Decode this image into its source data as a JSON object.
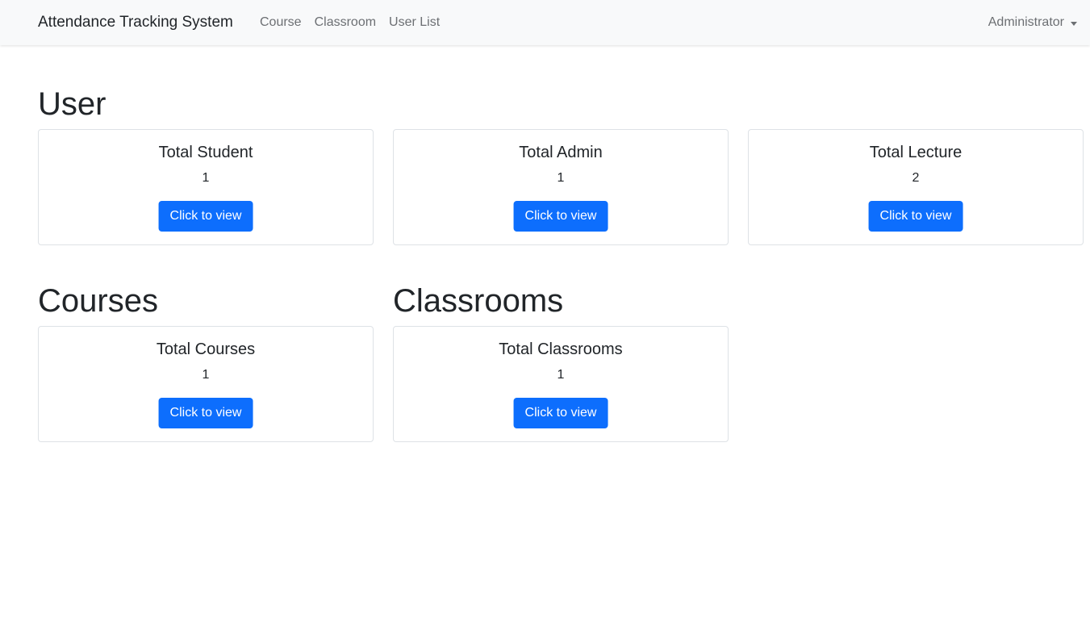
{
  "navbar": {
    "brand": "Attendance Tracking System",
    "links": [
      "Course",
      "Classroom",
      "User List"
    ],
    "user_menu": "Administrator"
  },
  "sections": {
    "user": {
      "title": "User",
      "cards": [
        {
          "title": "Total Student",
          "value": "1",
          "button": "Click to view"
        },
        {
          "title": "Total Admin",
          "value": "1",
          "button": "Click to view"
        },
        {
          "title": "Total Lecture",
          "value": "2",
          "button": "Click to view"
        }
      ]
    },
    "courses": {
      "title": "Courses",
      "cards": [
        {
          "title": "Total Courses",
          "value": "1",
          "button": "Click to view"
        }
      ]
    },
    "classrooms": {
      "title": "Classrooms",
      "cards": [
        {
          "title": "Total Classrooms",
          "value": "1",
          "button": "Click to view"
        }
      ]
    }
  },
  "colors": {
    "primary": "#0d6efd",
    "navbar_bg": "#f8f9fa",
    "nav_link": "#6c6f73",
    "text": "#212529",
    "card_border": "#dee2e6"
  }
}
